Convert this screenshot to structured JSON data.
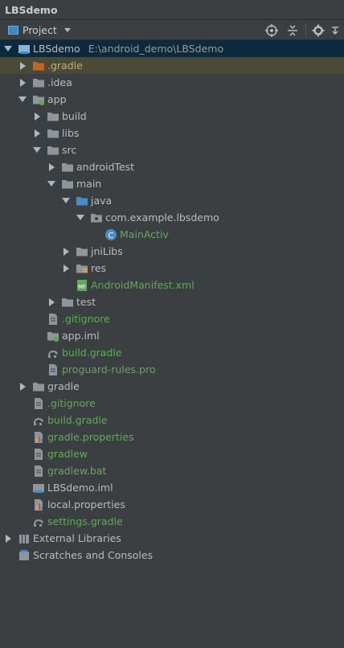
{
  "window": {
    "title": "LBSdemo"
  },
  "toolbar": {
    "view_label": "Project"
  },
  "tree": [
    {
      "label": "LBSdemo",
      "path": "E:\\android_demo\\LBSdemo",
      "icon": "module-icon",
      "arrow": "down",
      "color": "default"
    },
    {
      "label": ".gradle",
      "icon": "folder-orange-icon",
      "arrow": "right",
      "color": "orange"
    },
    {
      "label": ".idea",
      "icon": "folder-icon",
      "arrow": "right",
      "color": "default"
    },
    {
      "label": "app",
      "icon": "module-folder-icon",
      "arrow": "down",
      "color": "default"
    },
    {
      "label": "build",
      "icon": "folder-icon",
      "arrow": "right",
      "color": "default"
    },
    {
      "label": "libs",
      "icon": "folder-icon",
      "arrow": "right",
      "color": "default"
    },
    {
      "label": "src",
      "icon": "folder-icon",
      "arrow": "down",
      "color": "default"
    },
    {
      "label": "androidTest",
      "icon": "folder-icon",
      "arrow": "right",
      "color": "default"
    },
    {
      "label": "main",
      "icon": "folder-icon",
      "arrow": "down",
      "color": "default"
    },
    {
      "label": "java",
      "icon": "source-folder-icon",
      "arrow": "down",
      "color": "default"
    },
    {
      "label": "com.example.lbsdemo",
      "icon": "package-icon",
      "arrow": "down",
      "color": "default"
    },
    {
      "label": "MainActiv",
      "icon": "class-icon",
      "arrow": "none",
      "color": "green"
    },
    {
      "label": "jniLibs",
      "icon": "folder-icon",
      "arrow": "right",
      "color": "default"
    },
    {
      "label": "res",
      "icon": "resource-folder-icon",
      "arrow": "right",
      "color": "default"
    },
    {
      "label": "AndroidManifest.xml",
      "icon": "manifest-icon",
      "arrow": "none",
      "color": "green"
    },
    {
      "label": "test",
      "icon": "folder-icon",
      "arrow": "right",
      "color": "default"
    },
    {
      "label": ".gitignore",
      "icon": "text-file-icon",
      "arrow": "none",
      "color": "green"
    },
    {
      "label": "app.iml",
      "icon": "iml-file-icon",
      "arrow": "none",
      "color": "default"
    },
    {
      "label": "build.gradle",
      "icon": "gradle-icon",
      "arrow": "none",
      "color": "green"
    },
    {
      "label": "proguard-rules.pro",
      "icon": "text-file-icon",
      "arrow": "none",
      "color": "green"
    },
    {
      "label": "gradle",
      "icon": "folder-icon",
      "arrow": "right",
      "color": "default"
    },
    {
      "label": ".gitignore",
      "icon": "text-file-icon",
      "arrow": "none",
      "color": "green"
    },
    {
      "label": "build.gradle",
      "icon": "gradle-icon",
      "arrow": "none",
      "color": "green"
    },
    {
      "label": "gradle.properties",
      "icon": "properties-icon",
      "arrow": "none",
      "color": "green"
    },
    {
      "label": "gradlew",
      "icon": "text-file-icon",
      "arrow": "none",
      "color": "green"
    },
    {
      "label": "gradlew.bat",
      "icon": "text-file-icon",
      "arrow": "none",
      "color": "green"
    },
    {
      "label": "LBSdemo.iml",
      "icon": "module-file-icon",
      "arrow": "none",
      "color": "default"
    },
    {
      "label": "local.properties",
      "icon": "properties-icon",
      "arrow": "none",
      "color": "default"
    },
    {
      "label": "settings.gradle",
      "icon": "gradle-icon",
      "arrow": "none",
      "color": "green"
    },
    {
      "label": "External Libraries",
      "icon": "libraries-icon",
      "arrow": "right",
      "color": "default"
    },
    {
      "label": "Scratches and Consoles",
      "icon": "scratches-icon",
      "arrow": "none",
      "color": "default"
    }
  ],
  "colors": {
    "background": "#3c3f41",
    "folder": "#8f9599",
    "source_folder": "#4a8bc4",
    "green_text": "#62a85c",
    "orange_text": "#c9aa6a",
    "selection": "#4b4a37"
  }
}
